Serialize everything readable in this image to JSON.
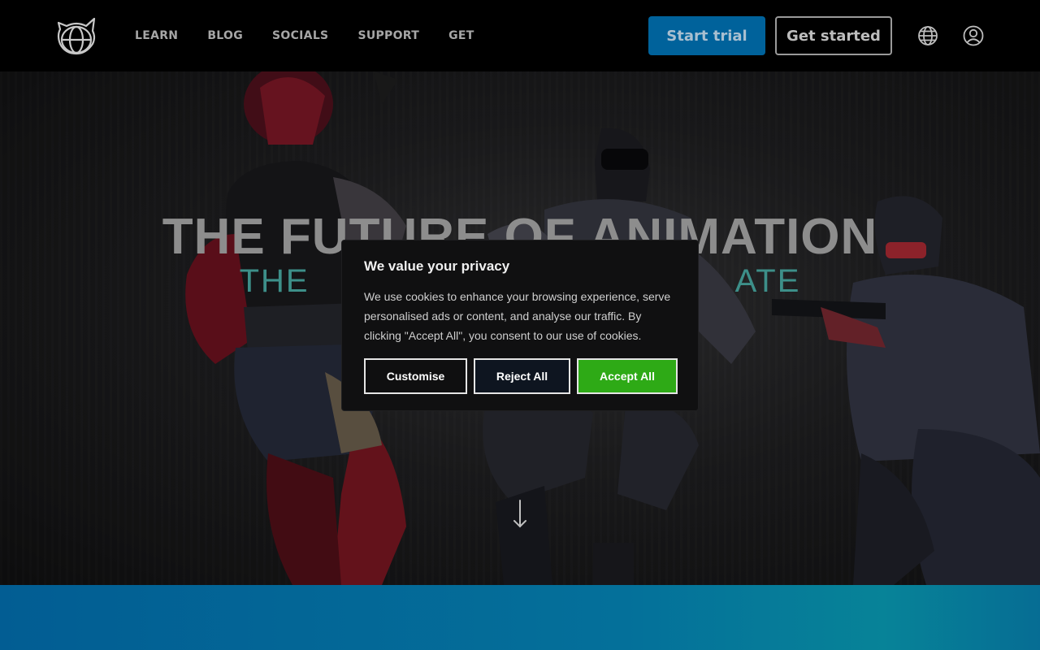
{
  "header": {
    "logo_icon": "cat-globe-logo-icon",
    "nav": [
      "LEARN",
      "BLOG",
      "SOCIALS",
      "SUPPORT",
      "GET"
    ],
    "start_trial_label": "Start trial",
    "get_started_label": "Get started",
    "globe_icon": "globe-icon",
    "user_icon": "user-account-icon",
    "colors": {
      "start_trial_bg": "#00629b",
      "background": "#000000"
    }
  },
  "hero": {
    "title": "THE FUTURE OF ANIMATION",
    "subtitle_left": "THE",
    "subtitle_right": "ATE",
    "scroll_icon": "down-arrow-icon"
  },
  "cookie_banner": {
    "title": "We value your privacy",
    "text": "We use cookies to enhance your browsing experience, serve personalised ads or content, and analyse our traffic. By clicking \"Accept All\", you consent to our use of cookies.",
    "customise_label": "Customise",
    "reject_label": "Reject All",
    "accept_label": "Accept All",
    "colors": {
      "accept_bg": "#2eaa16",
      "reject_bg": "#0e1520"
    }
  },
  "band": {
    "color": "#025d93"
  }
}
